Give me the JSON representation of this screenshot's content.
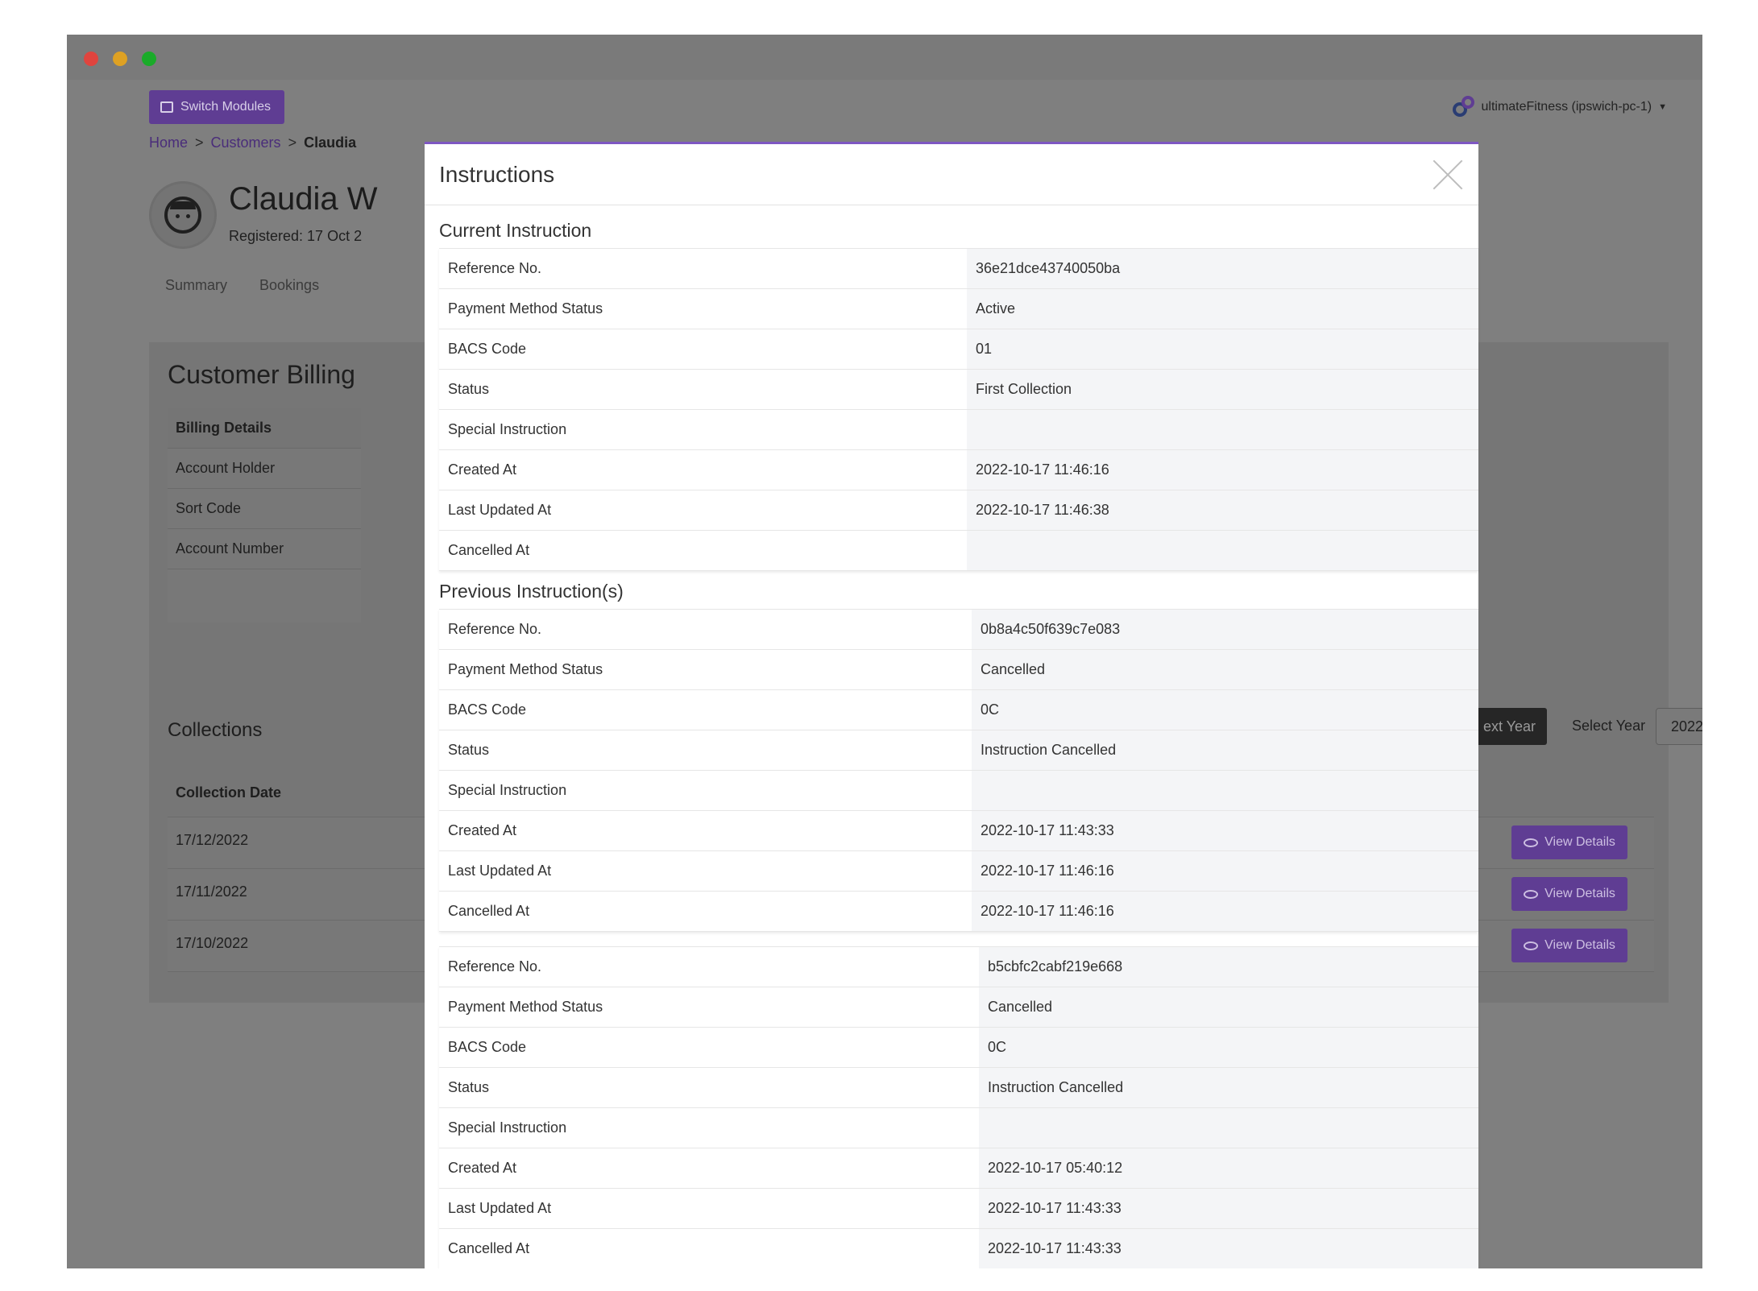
{
  "app": {
    "switch_modules_label": "Switch Modules",
    "tenant_label": "ultimateFitness (ipswich-pc-1)"
  },
  "breadcrumb": {
    "home": "Home",
    "customers": "Customers",
    "current": "Claudia"
  },
  "customer": {
    "name": "Claudia W",
    "registered": "Registered: 17 Oct 2"
  },
  "tabs": [
    "Summary",
    "Bookings"
  ],
  "billing": {
    "title": "Customer Billing",
    "header": "Billing Details",
    "rows": [
      "Account Holder",
      "Sort Code",
      "Account Number"
    ]
  },
  "collections": {
    "title": "Collections",
    "header": "Collection Date",
    "dates": [
      "17/12/2022",
      "17/11/2022",
      "17/10/2022"
    ],
    "view_details_label": "View Details",
    "next_year_label": "ext Year",
    "select_year_label": "Select Year",
    "selected_year": "2022"
  },
  "modal": {
    "title": "Instructions",
    "current_section_title": "Current Instruction",
    "previous_section_title": "Previous Instruction(s)",
    "current": [
      {
        "label": "Reference No.",
        "value": "36e21dce43740050ba"
      },
      {
        "label": "Payment Method Status",
        "value": "Active"
      },
      {
        "label": "BACS Code",
        "value": "01"
      },
      {
        "label": "Status",
        "value": "First Collection"
      },
      {
        "label": "Special Instruction",
        "value": ""
      },
      {
        "label": "Created At",
        "value": "2022-10-17 11:46:16"
      },
      {
        "label": "Last Updated At",
        "value": "2022-10-17 11:46:38"
      },
      {
        "label": "Cancelled At",
        "value": ""
      }
    ],
    "previous": [
      [
        {
          "label": "Reference No.",
          "value": "0b8a4c50f639c7e083"
        },
        {
          "label": "Payment Method Status",
          "value": "Cancelled"
        },
        {
          "label": "BACS Code",
          "value": "0C"
        },
        {
          "label": "Status",
          "value": "Instruction Cancelled"
        },
        {
          "label": "Special Instruction",
          "value": ""
        },
        {
          "label": "Created At",
          "value": "2022-10-17 11:43:33"
        },
        {
          "label": "Last Updated At",
          "value": "2022-10-17 11:46:16"
        },
        {
          "label": "Cancelled At",
          "value": "2022-10-17 11:46:16"
        }
      ],
      [
        {
          "label": "Reference No.",
          "value": "b5cbfc2cabf219e668"
        },
        {
          "label": "Payment Method Status",
          "value": "Cancelled"
        },
        {
          "label": "BACS Code",
          "value": "0C"
        },
        {
          "label": "Status",
          "value": "Instruction Cancelled"
        },
        {
          "label": "Special Instruction",
          "value": ""
        },
        {
          "label": "Created At",
          "value": "2022-10-17 05:40:12"
        },
        {
          "label": "Last Updated At",
          "value": "2022-10-17 11:43:33"
        },
        {
          "label": "Cancelled At",
          "value": "2022-10-17 11:43:33"
        }
      ]
    ]
  }
}
